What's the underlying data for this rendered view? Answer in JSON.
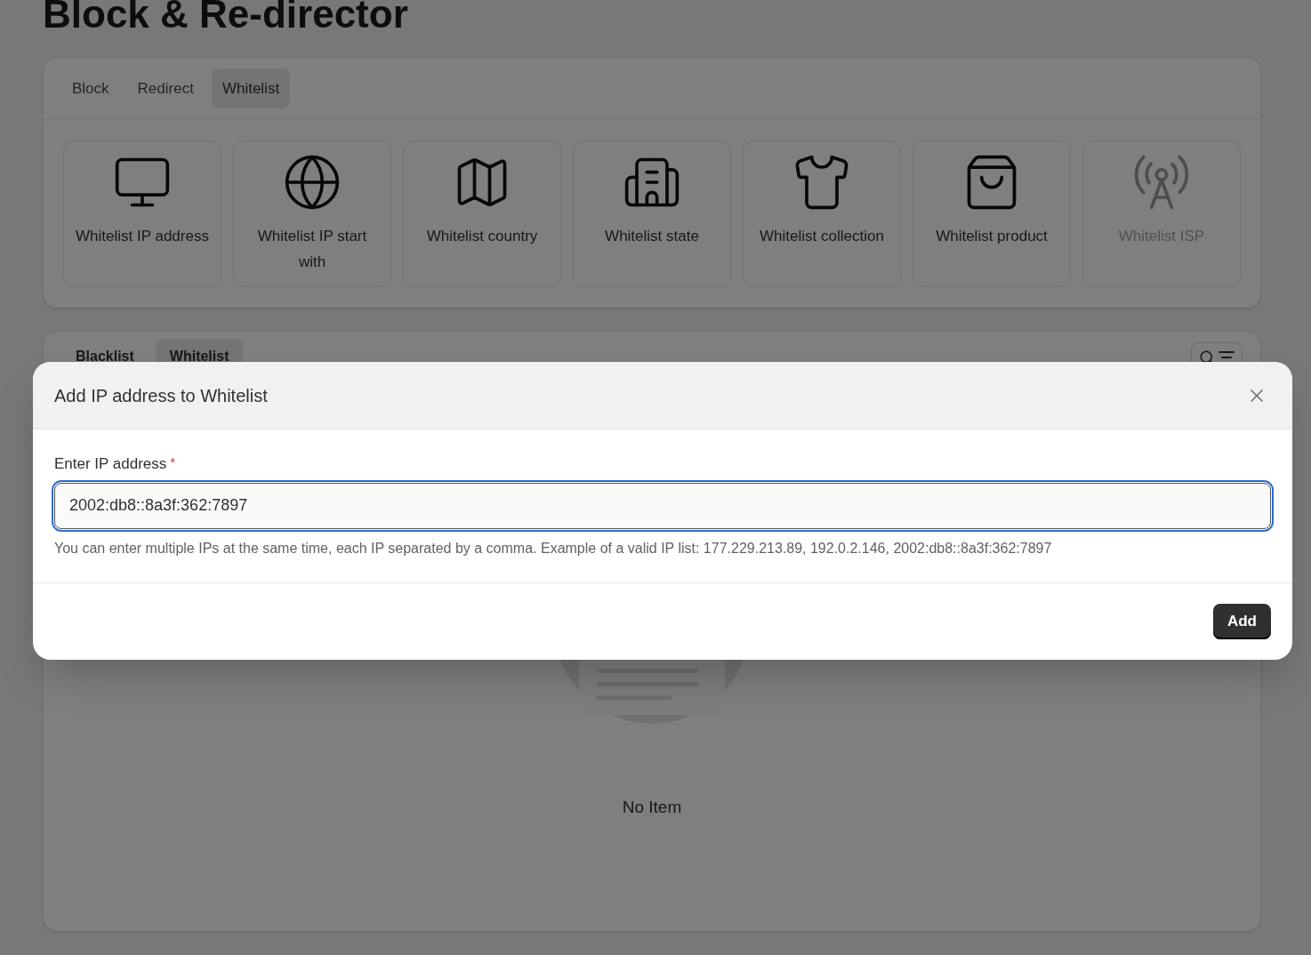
{
  "page": {
    "title": "Block & Re-director"
  },
  "main_tabs": [
    {
      "label": "Block",
      "selected": false
    },
    {
      "label": "Redirect",
      "selected": false
    },
    {
      "label": "Whitelist",
      "selected": true
    }
  ],
  "options": [
    {
      "label": "Whitelist IP address",
      "disabled": false
    },
    {
      "label": "Whitelist IP start with",
      "disabled": false
    },
    {
      "label": "Whitelist country",
      "disabled": false
    },
    {
      "label": "Whitelist state",
      "disabled": false
    },
    {
      "label": "Whitelist collection",
      "disabled": false
    },
    {
      "label": "Whitelist product",
      "disabled": false
    },
    {
      "label": "Whitelist ISP",
      "disabled": true
    }
  ],
  "list_tabs": [
    {
      "label": "Blacklist",
      "selected": false
    },
    {
      "label": "Whitelist",
      "selected": true
    }
  ],
  "empty_state": {
    "message": "No Item"
  },
  "dialog": {
    "title": "Add IP address to Whitelist",
    "field": {
      "label": "Enter IP address",
      "required": true,
      "required_mark": "*",
      "value": "2002:db8::8a3f:362:7897",
      "focused": true
    },
    "help": "You can enter multiple IPs at the same time, each IP separated by a comma. Example of a valid IP list: 177.229.213.89, 192.0.2.146, 2002:db8::8a3f:362:7897",
    "button": "Add"
  }
}
